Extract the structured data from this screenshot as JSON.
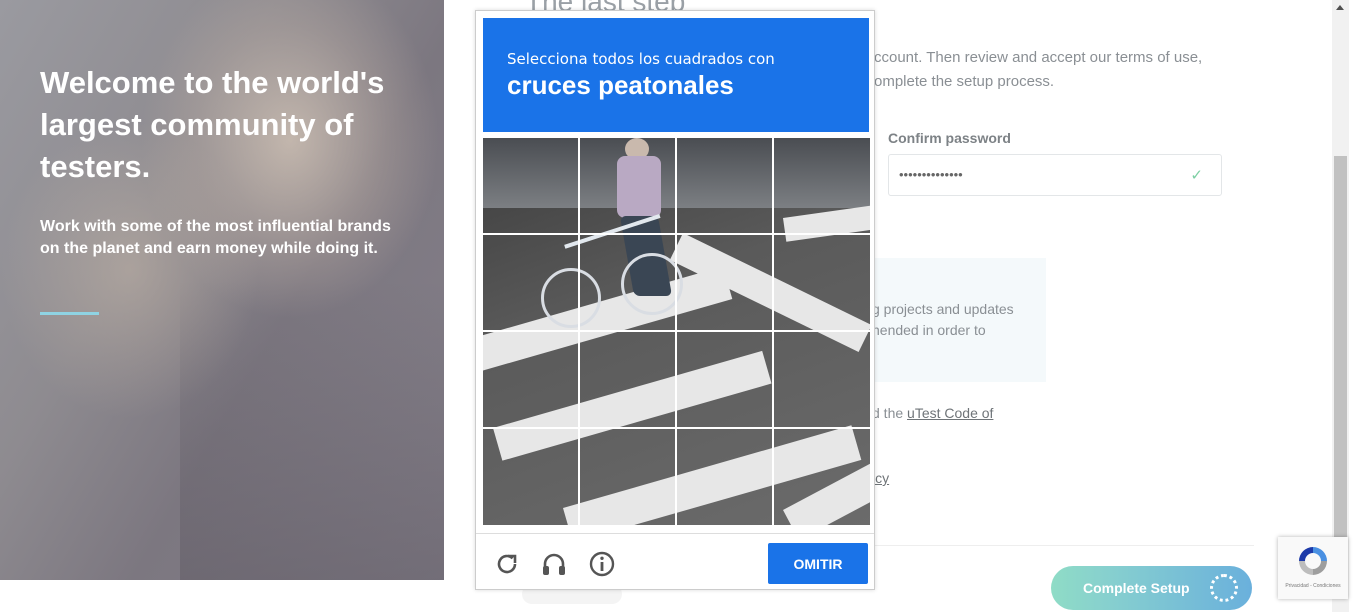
{
  "hero": {
    "title": "Welcome to the world's largest community of testers.",
    "subtitle": "Work with some of the most influential brands on the planet and earn money while doing it.",
    "accent_color": "#8fd3e3"
  },
  "form": {
    "step_title": "The last step",
    "intro_text": "ccount. Then review and accept our terms of use, omplete the setup process.",
    "confirm_password_label": "Confirm password",
    "confirm_password_value": "••••••••••••••",
    "check_icon": "checkmark-icon",
    "info_text": "g projects and updates nended in order to",
    "coc_prefix": "d the ",
    "coc_link": "uTest Code of",
    "policy_fragment": "icy",
    "complete_button": "Complete Setup"
  },
  "captcha": {
    "instruction": "Selecciona todos los cuadrados con",
    "target": "cruces peatonales",
    "grid_rows": 4,
    "grid_cols": 4,
    "icons": [
      "reload-icon",
      "audio-icon",
      "info-icon"
    ],
    "skip_button": "OMITIR",
    "header_color": "#1a73e8"
  },
  "recaptcha_badge": {
    "text": "Privacidad - Condiciones"
  }
}
